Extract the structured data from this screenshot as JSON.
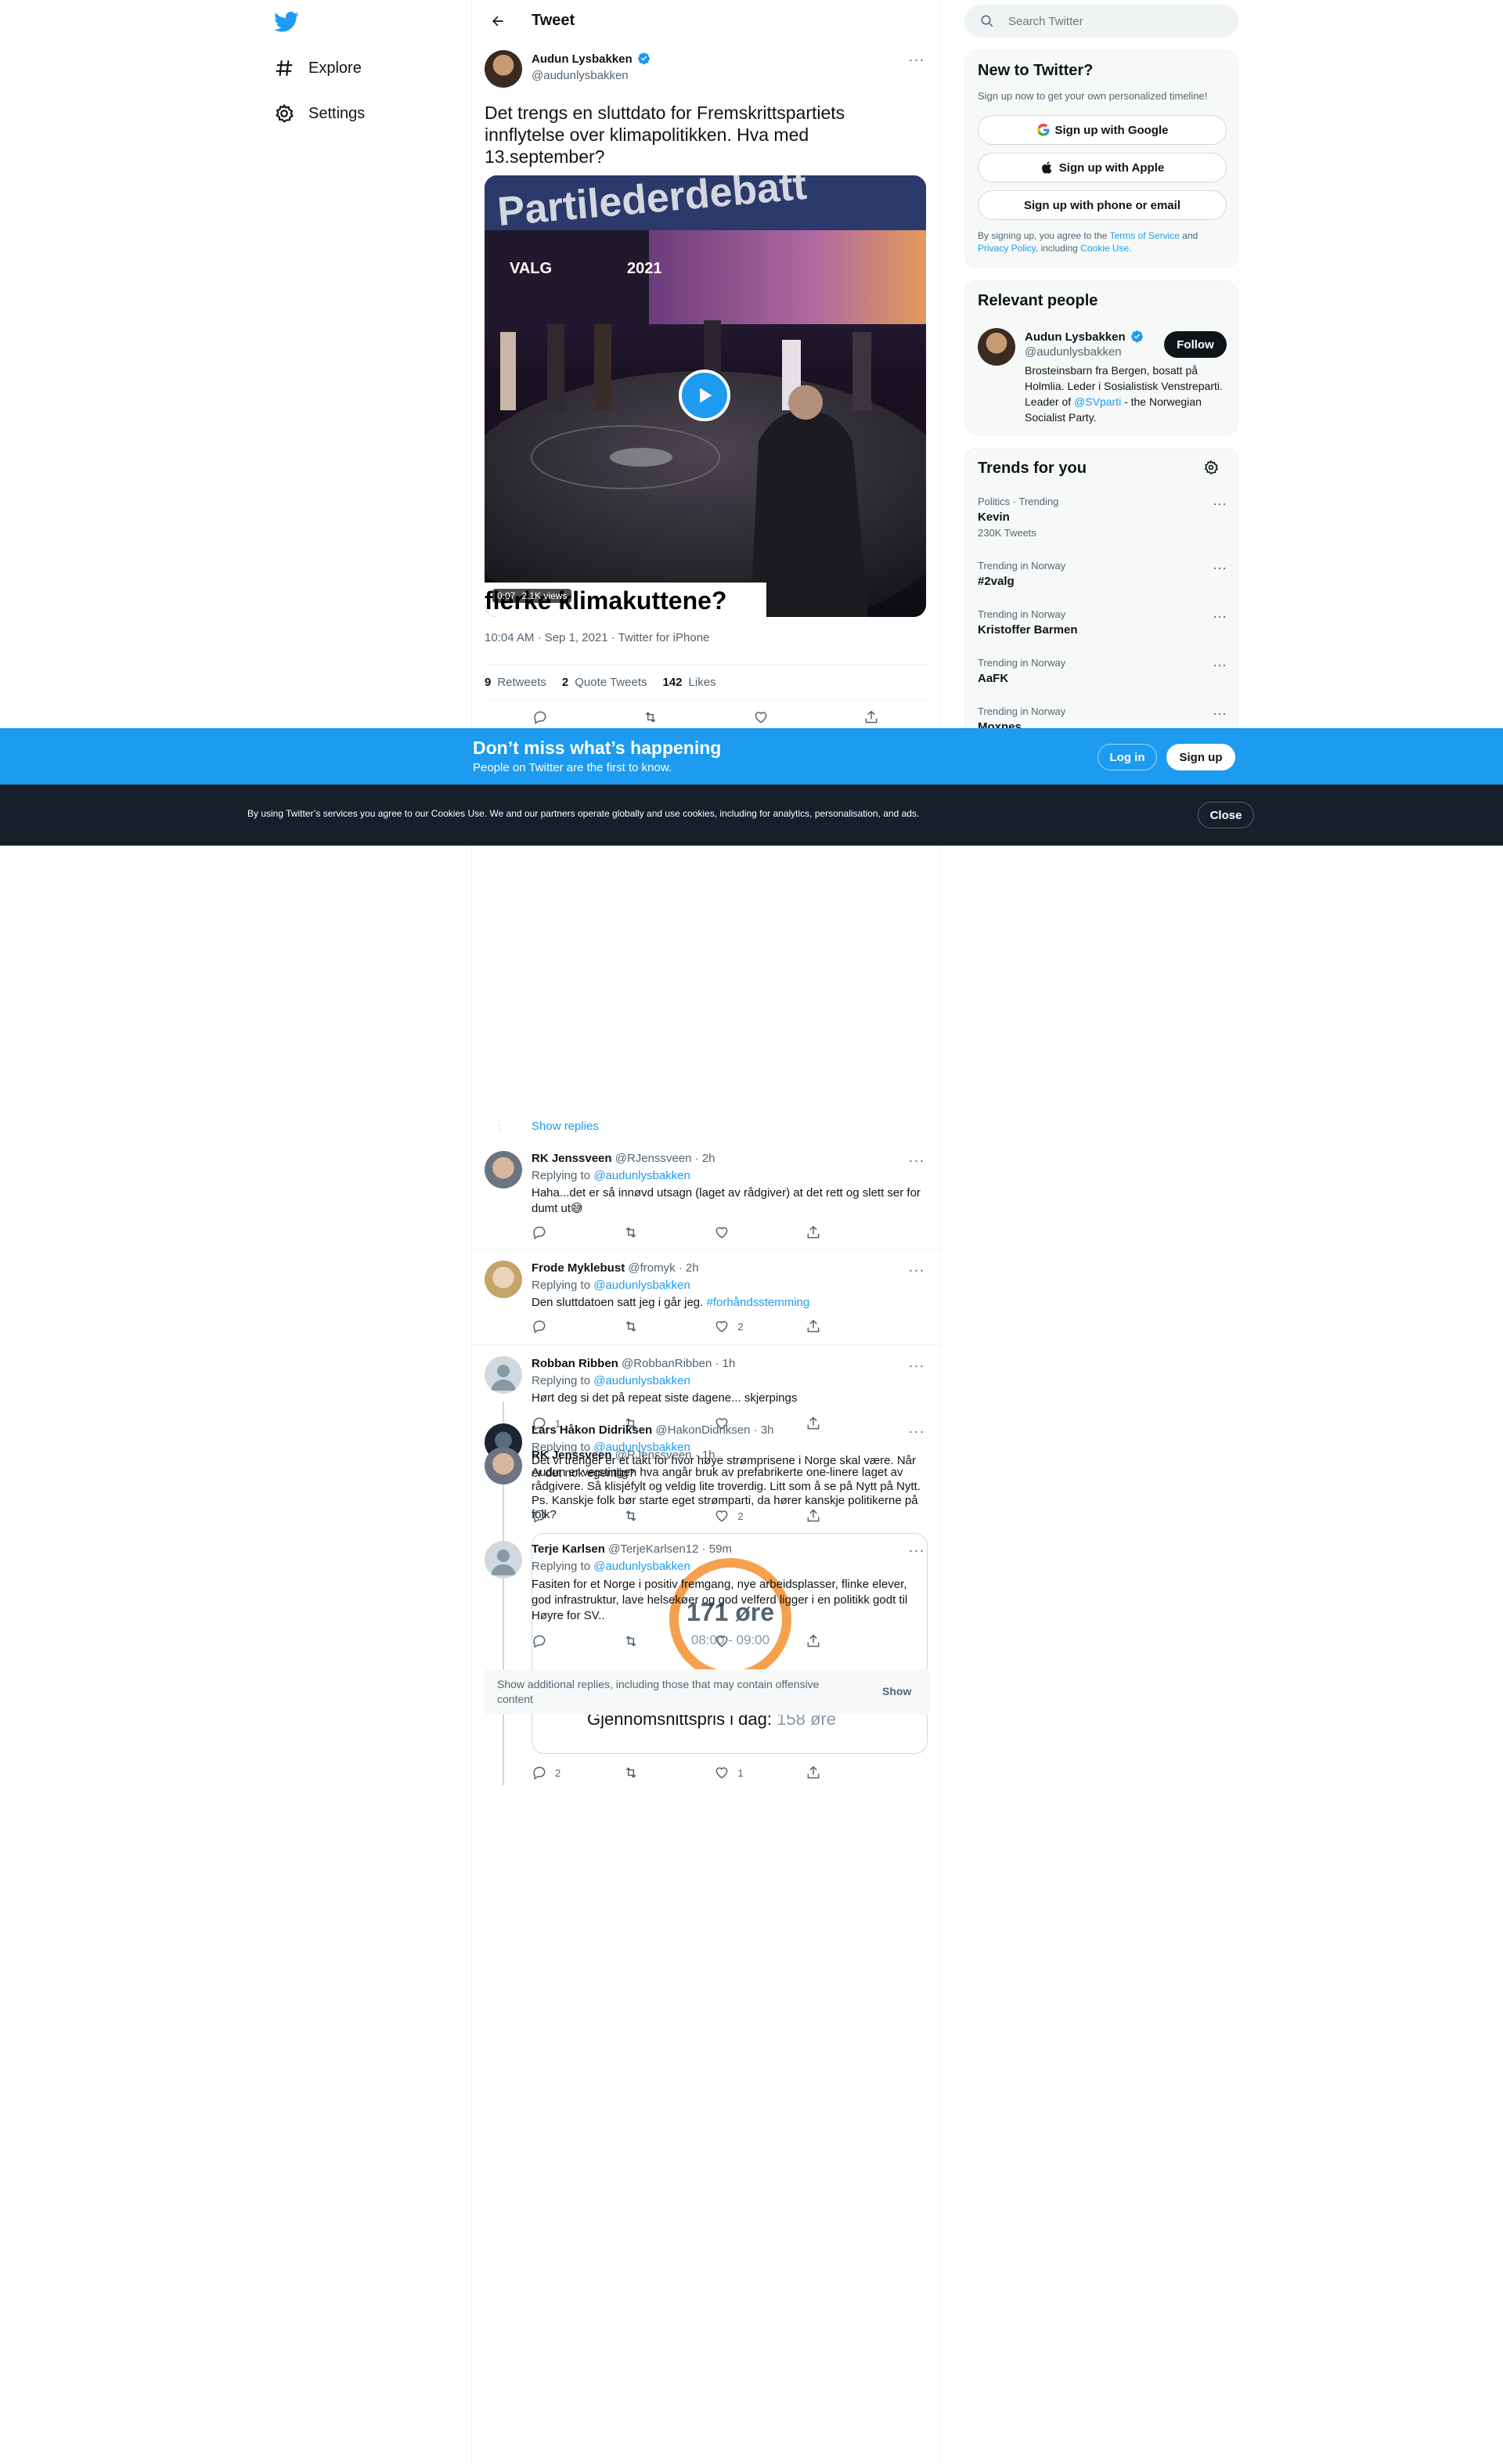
{
  "nav": {
    "explore": "Explore",
    "settings": "Settings"
  },
  "header": {
    "title": "Tweet"
  },
  "tweet": {
    "name": "Audun Lysbakken",
    "handle": "@audunlysbakken",
    "text": "Det trengs en sluttdato for Fremskrittspartiets innflytelse over klimapolitikken. Hva med 13.september?",
    "video": {
      "top_caption": "Partilederdebatt",
      "valg": "VALG",
      "year": "2021",
      "overlay_caption": "flerke klimakuttene?",
      "duration": "0:07",
      "views": "2.1K views"
    },
    "meta": "10:04 AM · Sep 1, 2021 · Twitter for iPhone",
    "stats": {
      "retweets_count": "9",
      "retweets_label": "Retweets",
      "quotes_count": "2",
      "quotes_label": "Quote Tweets",
      "likes_count": "142",
      "likes_label": "Likes"
    }
  },
  "show_replies": "Show replies",
  "replies": [
    {
      "name": "RK Jenssveen",
      "handle": "@RJenssveen · 2h",
      "replying": "Replying to",
      "to": "@audunlysbakken",
      "text": "Haha...det er så innøvd utsagn (laget av rådgiver) at det rett og slett ser for dumt ut😅",
      "reply_count": "",
      "retweet_count": "",
      "like_count": ""
    },
    {
      "name": "Frode Myklebust",
      "handle": "@fromyk · 2h",
      "replying": "Replying to",
      "to": "@audunlysbakken",
      "text": "Den sluttdatoen satt jeg i går jeg.",
      "hashtag": "#forhåndsstemming",
      "like_count": "2"
    },
    {
      "name": "Robban Ribben",
      "handle": "@RobbanRibben · 1h",
      "replying": "Replying to",
      "to": "@audunlysbakken",
      "text": "Hørt deg si det på repeat siste dagene... skjerpings",
      "reply_count": "1"
    },
    {
      "name": "Lars Håkon Didriksen",
      "handle": "@HakonDidriksen · 3h",
      "replying": "Replying to",
      "to": "@audunlysbakken",
      "text": "Det vi trenger er et takt for hvor høye strømprisene i Norge skal være. Når er det nok egentlig?"
    },
    {
      "name": "RK Jenssveen",
      "handle": "@RJenssveen · 1h",
      "text": "Audun er verstingen hva angår bruk av prefabrikerte one-linere laget av rådgivere. Så klisjéfylt og veldig lite troverdig. Litt som å se på Nytt på Nytt. Ps. Kanskje folk bør starte eget strømparti, da hører kanskje politikerne på folk?",
      "like_count": "2"
    },
    {
      "name": "Terje Karlsen",
      "handle": "@TerjeKarlsen12 · 59m",
      "replying": "Replying to",
      "to": "@audunlysbakken",
      "text": "Fasiten for et Norge i positiv fremgang, nye arbeidsplasser, flinke elever, god infrastruktur, lave helsekøer og god velferd ligger i en politikk godt til Høyre for SV.."
    }
  ],
  "price_card": {
    "value": "171 øre",
    "time": "08:00 - 09:00",
    "footer_label": "Gjennomsnittspris i dag:",
    "footer_value": "158 øre"
  },
  "offensive": {
    "text": "Show additional replies, including those that may contain offensive content",
    "button": "Show"
  },
  "bottom_actions": {
    "reply_count": "2",
    "like_count": "1"
  },
  "search": {
    "placeholder": "Search Twitter"
  },
  "new_to_twitter": {
    "title": "New to Twitter?",
    "subtitle": "Sign up now to get your own personalized timeline!",
    "google": "Sign up with Google",
    "apple": "Sign up with Apple",
    "phone": "Sign up with phone or email",
    "legal_prefix": "By signing up, you agree to the",
    "tos": "Terms of Service",
    "and": "and",
    "privacy": "Privacy Policy",
    "including": ", including",
    "cookie": "Cookie Use."
  },
  "relevant": {
    "title": "Relevant people",
    "name": "Audun Lysbakken",
    "handle": "@audunlysbakken",
    "follow": "Follow",
    "bio_1": "Brosteinsbarn fra Bergen, bosatt på Holmlia. Leder i Sosialistisk Venstreparti. Leader of",
    "bio_link": "@SVparti",
    "bio_2": "- the Norwegian Socialist Party."
  },
  "trends": {
    "title": "Trends for you",
    "items": [
      {
        "context": "Politics · Trending",
        "topic": "Kevin",
        "count": "230K Tweets"
      },
      {
        "context": "Trending in Norway",
        "topic": "#2valg",
        "count": ""
      },
      {
        "context": "Trending in Norway",
        "topic": "Kristoffer Barmen",
        "count": ""
      },
      {
        "context": "Trending in Norway",
        "topic": "AaFK",
        "count": ""
      },
      {
        "context": "Trending in Norway",
        "topic": "Moxnes",
        "count": ""
      }
    ]
  },
  "banner": {
    "title": "Don’t miss what’s happening",
    "subtitle": "People on Twitter are the first to know.",
    "login": "Log in",
    "signup": "Sign up"
  },
  "cookie": {
    "text": "By using Twitter’s services you agree to our Cookies Use. We and our partners operate globally and use cookies, including for analytics, personalisation, and ads.",
    "close": "Close"
  },
  "colors": {
    "accent": "#1d9bf0",
    "dark": "#0f1419",
    "muted": "#536471",
    "cookie_bg": "#15202b"
  }
}
